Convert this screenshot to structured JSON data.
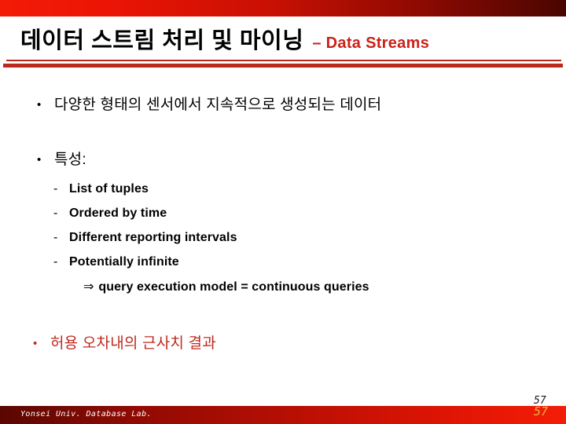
{
  "slide": {
    "title_korean": "데이터 스트림 처리 및 마이닝",
    "title_separator_and_english": "– Data Streams",
    "bullets": [
      {
        "marker": "•",
        "text": "다양한 형태의 센서에서 지속적으로 생성되는 데이터"
      },
      {
        "marker": "•",
        "text": "특성:"
      },
      {
        "marker": "•",
        "text": "허용 오차내의 근사치 결과"
      }
    ],
    "sub_bullets": [
      {
        "marker": "-",
        "text": "List of tuples"
      },
      {
        "marker": "-",
        "text": "Ordered by time"
      },
      {
        "marker": "-",
        "text": "Different reporting intervals"
      },
      {
        "marker": "-",
        "text": "Potentially infinite"
      }
    ],
    "conclusion": {
      "arrow": "⇒",
      "text": "query execution model = continuous queries"
    }
  },
  "footer": {
    "lab_credit": "Yonsei Univ. Database Lab.",
    "page_number": "57",
    "page_number_shadow": "57"
  },
  "colors": {
    "banner_red_bright": "#f41a06",
    "banner_red_dark": "#4a0501",
    "accent_red": "#c0291e",
    "title_english_red": "#cc2118",
    "page_number_gold": "#e8b93a",
    "text_black": "#000000"
  }
}
